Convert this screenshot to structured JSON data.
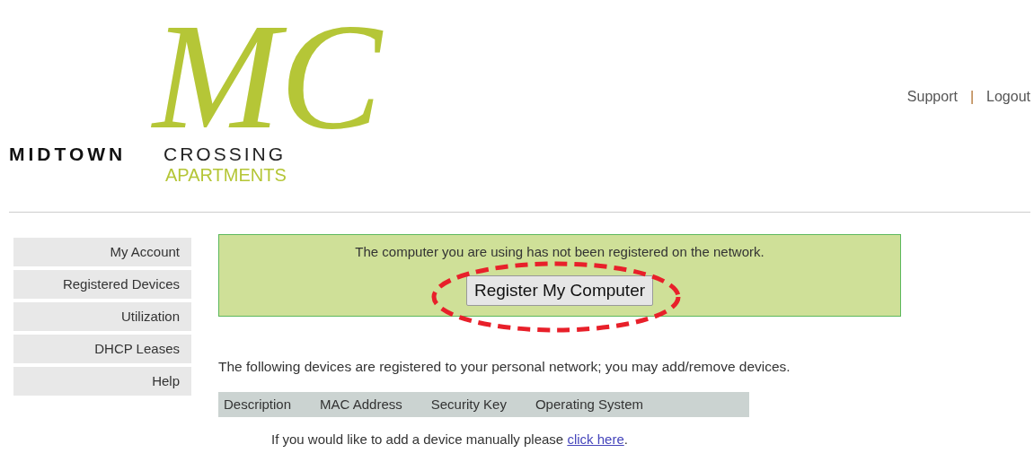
{
  "logo": {
    "monogram": "MC",
    "name_left": "MIDTOWN",
    "name_right": "CROSSING",
    "subtitle": "APARTMENTS"
  },
  "top_links": [
    {
      "label": "Support"
    },
    {
      "label": "Logout"
    }
  ],
  "top_links_separator": "|",
  "sidebar": {
    "items": [
      {
        "label": "My Account"
      },
      {
        "label": "Registered Devices"
      },
      {
        "label": "Utilization"
      },
      {
        "label": "DHCP Leases"
      },
      {
        "label": "Help"
      }
    ]
  },
  "notice": {
    "message": "The computer you are using has not been registered on the network.",
    "button": "Register My Computer",
    "highlighted": true
  },
  "intro": "The following devices are registered to your personal network; you may add/remove devices.",
  "table": {
    "columns": [
      "Description",
      "MAC Address",
      "Security Key",
      "Operating System"
    ]
  },
  "footer_note": {
    "text": "If you would like to add a device manually please ",
    "link": "click here",
    "after": "."
  }
}
